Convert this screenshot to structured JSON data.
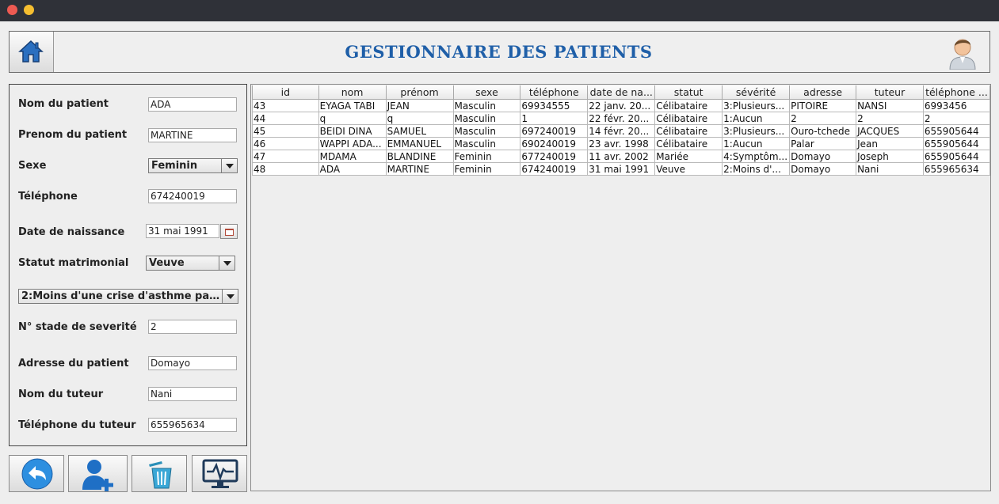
{
  "header": {
    "title": "GESTIONNAIRE DES PATIENTS",
    "home_icon": "home-icon",
    "user_icon": "user-avatar-icon",
    "accent": "#1f5fa8"
  },
  "form": {
    "nom_label": "Nom du patient",
    "nom_value": "ADA",
    "prenom_label": "Prenom du patient",
    "prenom_value": "MARTINE",
    "sexe_label": "Sexe",
    "sexe_value": "Feminin",
    "tel_label": "Téléphone",
    "tel_value": "674240019",
    "naissance_label": "Date de naissance",
    "naissance_value": "31 mai 1991",
    "statut_label": "Statut matrimonial",
    "statut_value": "Veuve",
    "severite_value": "2:Moins d'une crise d'asthme par...",
    "stade_label": "N° stade de severité",
    "stade_value": "2",
    "adresse_label": "Adresse du patient",
    "adresse_value": "Domayo",
    "tuteur_label": "Nom du tuteur",
    "tuteur_value": "Nani",
    "tel_tuteur_label": "Téléphone du tuteur",
    "tel_tuteur_value": "655965634"
  },
  "actions": {
    "back_icon": "back-arrow-icon",
    "add_icon": "add-user-icon",
    "delete_icon": "trash-icon",
    "monitor_icon": "monitor-icon"
  },
  "table": {
    "columns": [
      "id",
      "nom",
      "prénom",
      "sexe",
      "téléphone",
      "date de na...",
      "statut",
      "sévérité",
      "adresse",
      "tuteur",
      "téléphone ..."
    ],
    "rows": [
      [
        "43",
        "EYAGA TABI",
        "JEAN",
        "Masculin",
        "69934555",
        "22 janv. 20...",
        "Célibataire",
        "3:Plusieurs...",
        "PITOIRE",
        "NANSI",
        "6993456"
      ],
      [
        "44",
        "q",
        "q",
        "Masculin",
        "1",
        "22 févr. 20...",
        "Célibataire",
        "1:Aucun",
        "2",
        "2",
        "2"
      ],
      [
        "45",
        "BEIDI DINA",
        "SAMUEL",
        "Masculin",
        "697240019",
        "14 févr. 20...",
        "Célibataire",
        "3:Plusieurs...",
        "Ouro-tchede",
        "JACQUES",
        "655905644"
      ],
      [
        "46",
        "WAPPI ADA...",
        "EMMANUEL",
        "Masculin",
        "690240019",
        "23 avr. 1998",
        "Célibataire",
        "1:Aucun",
        "Palar",
        "Jean",
        "655905644"
      ],
      [
        "47",
        "MDAMA",
        "BLANDINE",
        "Feminin",
        "677240019",
        "11 avr. 2002",
        "Mariée",
        "4:Symptôm...",
        "Domayo",
        "Joseph",
        "655905644"
      ],
      [
        "48",
        "ADA",
        "MARTINE",
        "Feminin",
        "674240019",
        "31 mai 1991",
        "Veuve",
        "2:Moins d'...",
        "Domayo",
        "Nani",
        "655965634"
      ]
    ]
  }
}
